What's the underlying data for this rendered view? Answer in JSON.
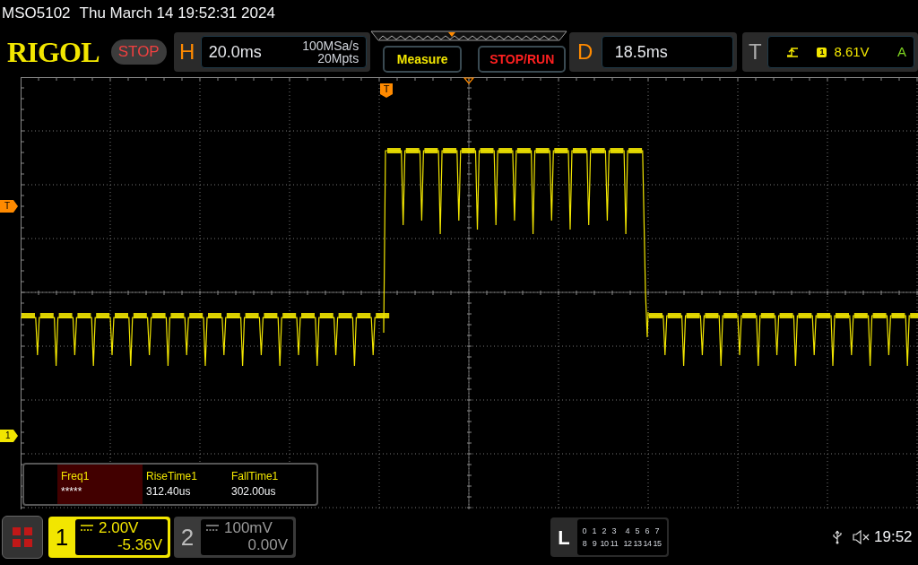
{
  "header": {
    "model": "MSO5102",
    "datetime": "Thu March 14 19:52:31 2024"
  },
  "toolbar": {
    "logo": "RIGOL",
    "run_state": "STOP",
    "horizontal": {
      "label": "H",
      "timebase": "20.0ms",
      "sample_rate": "100MSa/s",
      "memory_depth": "20Mpts"
    },
    "buttons": [
      {
        "label": "Measure",
        "kind": "menu"
      },
      {
        "label": "STOP/RUN",
        "kind": "run"
      }
    ],
    "delay": {
      "label": "D",
      "value": "18.5ms"
    },
    "trigger": {
      "label": "T",
      "source": "1",
      "level": "8.61V",
      "mode": "A"
    }
  },
  "markers": {
    "trigger_position": "T",
    "trigger_level": "T",
    "channel": "1"
  },
  "measurements": [
    {
      "name": "Freq1",
      "value": "*****",
      "selected": true
    },
    {
      "name": "RiseTime1",
      "value": "312.40us",
      "selected": false
    },
    {
      "name": "FallTime1",
      "value": "302.00us",
      "selected": false
    }
  ],
  "channels": [
    {
      "number": "1",
      "scale": "2.00V",
      "offset": "-5.36V",
      "selected": true
    },
    {
      "number": "2",
      "scale": "100mV",
      "offset": "0.00V",
      "selected": false
    }
  ],
  "logic": {
    "label": "L",
    "rows": [
      [
        "0",
        "1",
        "2",
        "3",
        "4",
        "5",
        "6",
        "7"
      ],
      [
        "8",
        "9",
        "10",
        "11",
        "12",
        "13",
        "14",
        "15"
      ]
    ]
  },
  "status": {
    "time": "19:52"
  }
}
